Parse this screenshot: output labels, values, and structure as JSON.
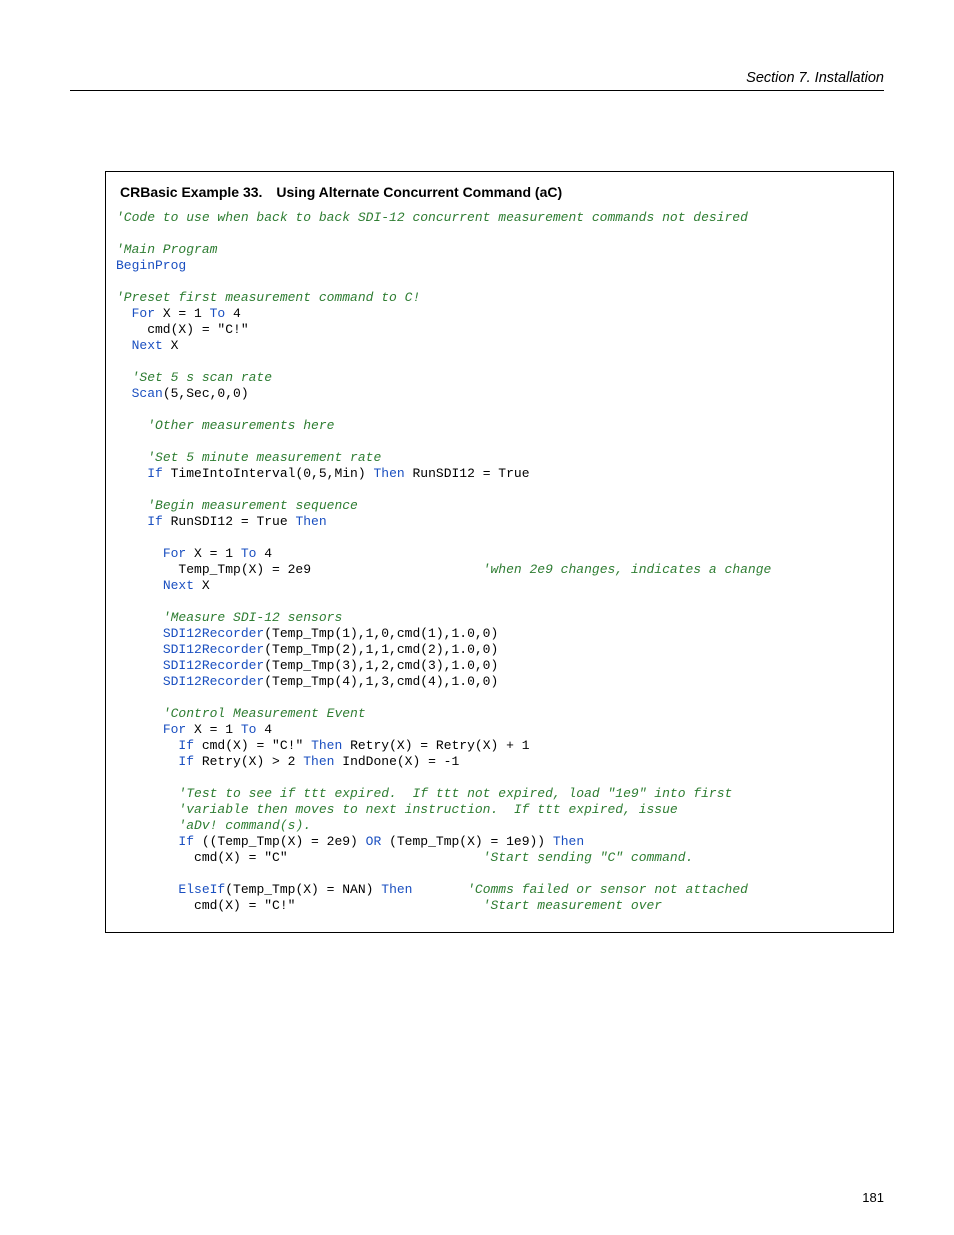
{
  "header": {
    "section": "Section 7.  Installation"
  },
  "example": {
    "label": "CRBasic Example 33.",
    "title": "Using Alternate Concurrent Command (aC)"
  },
  "code": {
    "l01": "'Code to use when back to back SDI-12 concurrent measurement commands not desired",
    "l02": "'Main Program",
    "l03": "BeginProg",
    "l04": "'Preset first measurement command to C!",
    "l05_for": "For",
    "l05_mid": " X = 1 ",
    "l05_to": "To",
    "l05_end": " 4",
    "l06": "    cmd(X) = \"C!\"",
    "l07_next": "Next",
    "l07_end": " X",
    "l08": "'Set 5 s scan rate",
    "l09_scan": "Scan",
    "l09_args": "(5,Sec,0,0)",
    "l10": "'Other measurements here",
    "l11": "'Set 5 minute measurement rate",
    "l12_if": "If",
    "l12_mid": " TimeIntoInterval(0,5,Min) ",
    "l12_then": "Then",
    "l12_end": " RunSDI12 = True",
    "l13": "'Begin measurement sequence",
    "l14_if": "If",
    "l14_mid": " RunSDI12 = True ",
    "l14_then": "Then",
    "l15_for": "For",
    "l15_mid": " X = 1 ",
    "l15_to": "To",
    "l15_end": " 4",
    "l16_a": "        Temp_Tmp(X) = 2e9                      ",
    "l16_c": "'when 2e9 changes, indicates a change",
    "l17_next": "Next",
    "l17_end": " X",
    "l18": "'Measure SDI-12 sensors",
    "l19_k": "SDI12Recorder",
    "l19_a": "(Temp_Tmp(1),1,0,cmd(1),1.0,0)",
    "l20_k": "SDI12Recorder",
    "l20_a": "(Temp_Tmp(2),1,1,cmd(2),1.0,0)",
    "l21_k": "SDI12Recorder",
    "l21_a": "(Temp_Tmp(3),1,2,cmd(3),1.0,0)",
    "l22_k": "SDI12Recorder",
    "l22_a": "(Temp_Tmp(4),1,3,cmd(4),1.0,0)",
    "l23": "'Control Measurement Event",
    "l24_for": "For",
    "l24_mid": " X = 1 ",
    "l24_to": "To",
    "l24_end": " 4",
    "l25_if": "If",
    "l25_mid": " cmd(X) = \"C!\" ",
    "l25_then": "Then",
    "l25_end": " Retry(X) = Retry(X) + 1",
    "l26_if": "If",
    "l26_mid": " Retry(X) > 2 ",
    "l26_then": "Then",
    "l26_end": " IndDone(X) = -1",
    "l27": "'Test to see if ttt expired.  If ttt not expired, load \"1e9\" into first",
    "l28": "'variable then moves to next instruction.  If ttt expired, issue",
    "l29": "'aDv! command(s).",
    "l30_if": "If",
    "l30_a": " ((Temp_Tmp(X) = 2e9) ",
    "l30_or": "OR",
    "l30_b": " (Temp_Tmp(X) = 1e9)) ",
    "l30_then": "Then",
    "l31_a": "          cmd(X) = \"C\"                         ",
    "l31_c": "'Start sending \"C\" command.",
    "l32_k": "ElseIf",
    "l32_a": "(Temp_Tmp(X) = NAN) ",
    "l32_then": "Then",
    "l32_pad": "       ",
    "l32_c": "'Comms failed or sensor not attached",
    "l33_a": "          cmd(X) = \"C!\"                        ",
    "l33_c": "'Start measurement over"
  },
  "page_number": "181"
}
